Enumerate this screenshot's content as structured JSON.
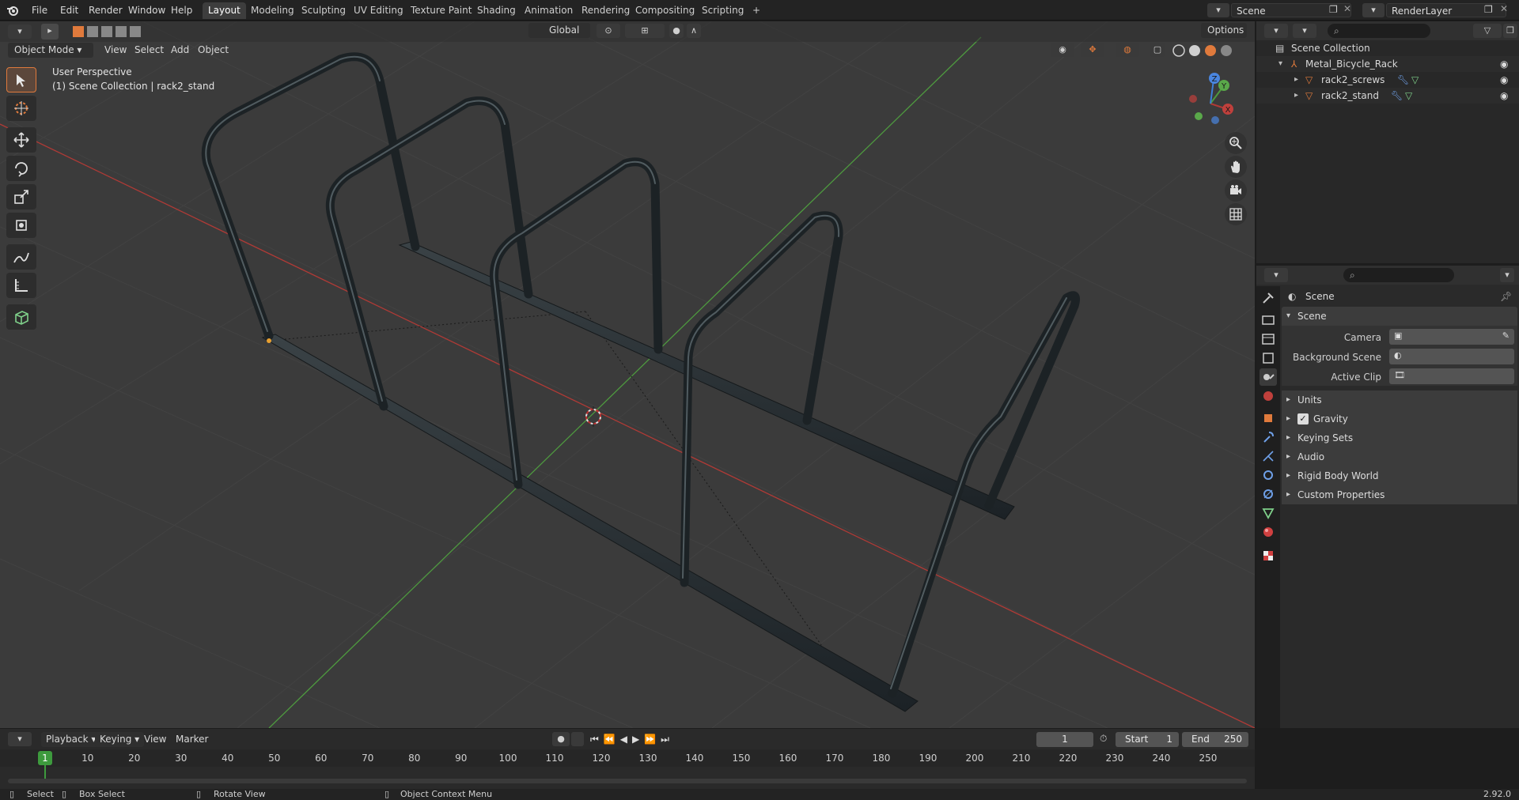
{
  "topbar": {
    "menus": [
      "File",
      "Edit",
      "Render",
      "Window",
      "Help"
    ],
    "workspaces": [
      "Layout",
      "Modeling",
      "Sculpting",
      "UV Editing",
      "Texture Paint",
      "Shading",
      "Animation",
      "Rendering",
      "Compositing",
      "Scripting"
    ],
    "active_workspace": "Layout",
    "add_workspace": "+",
    "scene_name": "Scene",
    "view_layer_name": "RenderLayer"
  },
  "viewport": {
    "mode": "Object Mode",
    "menus": [
      "View",
      "Select",
      "Add",
      "Object"
    ],
    "orientation": "Global",
    "options_label": "Options",
    "perspective_label": "User Perspective",
    "collection_label": "(1) Scene Collection | rack2_stand",
    "gizmo_axes": [
      "X",
      "Y",
      "Z"
    ]
  },
  "outliner": {
    "root": "Scene Collection",
    "items": [
      {
        "name": "Metal_Bicycle_Rack",
        "depth": 1
      },
      {
        "name": "rack2_screws",
        "depth": 2
      },
      {
        "name": "rack2_stand",
        "depth": 2
      }
    ]
  },
  "properties": {
    "header": "Scene",
    "panel": "Scene",
    "fields": [
      {
        "label": "Camera"
      },
      {
        "label": "Background Scene"
      },
      {
        "label": "Active Clip"
      }
    ],
    "sections": [
      "Units",
      "Gravity",
      "Keying Sets",
      "Audio",
      "Rigid Body World",
      "Custom Properties"
    ],
    "gravity_checked": true
  },
  "timeline": {
    "menus": [
      "Playback",
      "Keying",
      "View",
      "Marker"
    ],
    "current_frame": "1",
    "start_label": "Start",
    "start_value": "1",
    "end_label": "End",
    "end_value": "250",
    "ruler": [
      "1",
      "10",
      "20",
      "30",
      "40",
      "50",
      "60",
      "70",
      "80",
      "90",
      "100",
      "110",
      "120",
      "130",
      "140",
      "150",
      "160",
      "170",
      "180",
      "190",
      "200",
      "210",
      "220",
      "230",
      "240",
      "250"
    ]
  },
  "statusbar": {
    "select": "Select",
    "box_select": "Box Select",
    "rotate_view": "Rotate View",
    "context_menu": "Object Context Menu",
    "version": "2.92.0"
  },
  "colors": {
    "accent": "#e07a3c",
    "x_axis": "#b03a36",
    "y_axis": "#4e9a3f",
    "z_axis": "#3d7fd8",
    "frame_indicator": "#3d9a3d"
  }
}
